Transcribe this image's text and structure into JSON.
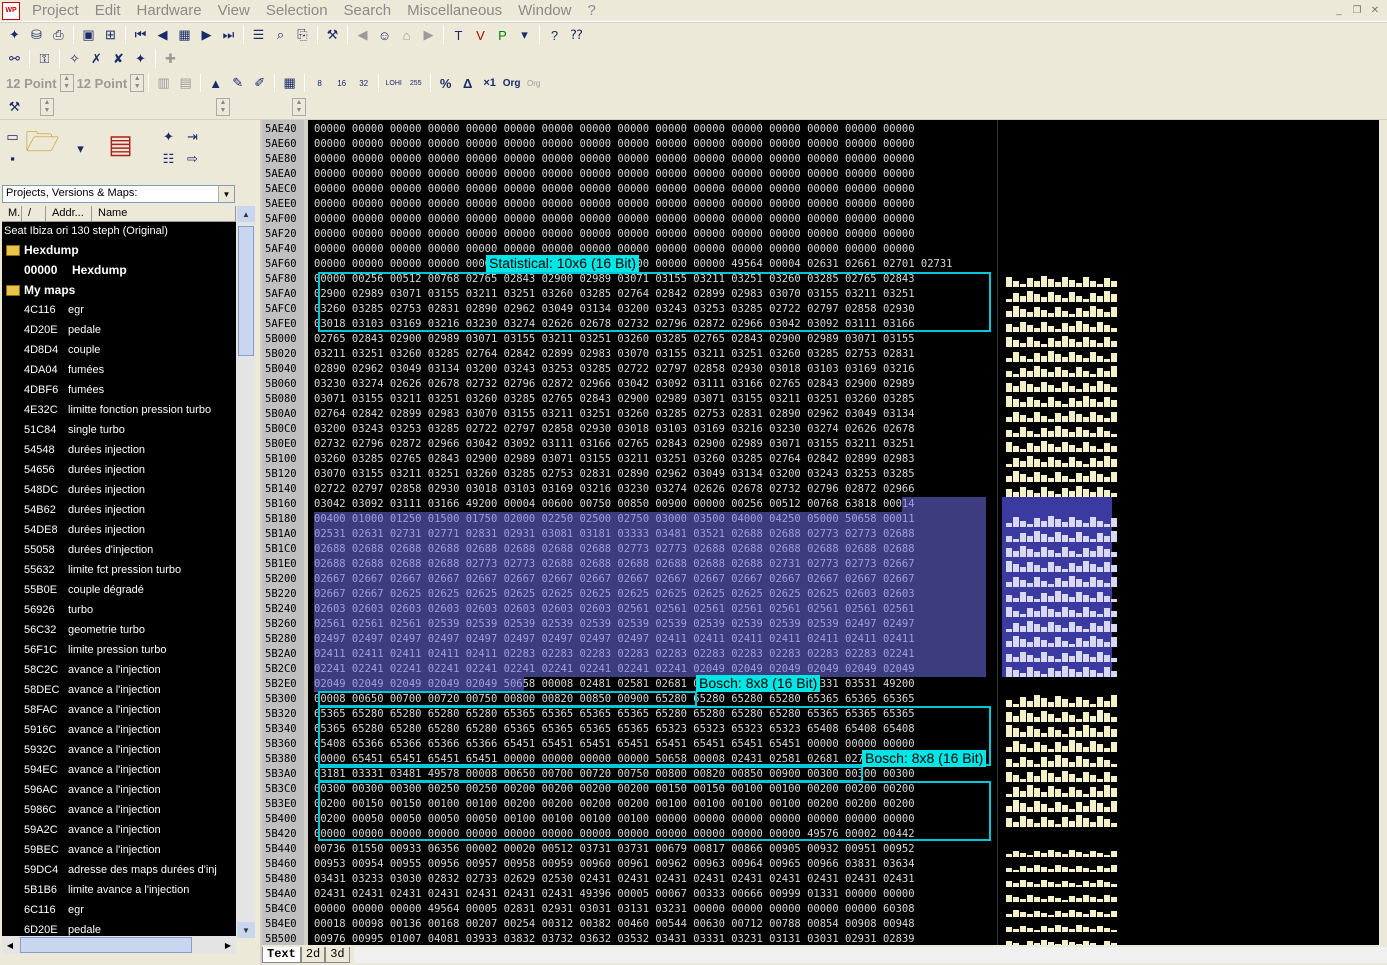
{
  "menu": [
    "Project",
    "Edit",
    "Hardware",
    "View",
    "Selection",
    "Search",
    "Miscellaneous",
    "Window",
    "?"
  ],
  "font_label_1": "12 Point",
  "font_label_2": "12 Point",
  "projects_combo": "Projects, Versions & Maps:",
  "list_headers": [
    "M.",
    "/",
    "Addr...",
    "Name"
  ],
  "project_root": "Seat Ibiza ori 130 steph (Original)",
  "group_hexdump": "Hexdump",
  "hexdump_row": {
    "addr": "00000",
    "name": "Hexdump"
  },
  "group_maps": "My maps",
  "maps": [
    [
      "4C116",
      "egr"
    ],
    [
      "4D20E",
      "pedale"
    ],
    [
      "4D8D4",
      "couple"
    ],
    [
      "4DA04",
      "fumées"
    ],
    [
      "4DBF6",
      "fumées"
    ],
    [
      "4E32C",
      "limitte fonction pression turbo"
    ],
    [
      "51C84",
      "single turbo"
    ],
    [
      "54548",
      "durées injection"
    ],
    [
      "54656",
      "durées injection"
    ],
    [
      "548DC",
      "durées injection"
    ],
    [
      "54B62",
      "durées injection"
    ],
    [
      "54DE8",
      "durées injection"
    ],
    [
      "55058",
      "durées d'injection"
    ],
    [
      "55632",
      "limite fct pression turbo"
    ],
    [
      "55B0E",
      "couple dégradé"
    ],
    [
      "56926",
      "turbo"
    ],
    [
      "56C32",
      "geometrie turbo"
    ],
    [
      "56F1C",
      "limite pression turbo"
    ],
    [
      "58C2C",
      "avance a l'injection"
    ],
    [
      "58DEC",
      "avance a l'injection"
    ],
    [
      "58FAC",
      "avance a l'injection"
    ],
    [
      "5916C",
      "avance a l'injection"
    ],
    [
      "5932C",
      "avance a l'injection"
    ],
    [
      "594EC",
      "avance a l'injection"
    ],
    [
      "596AC",
      "avance a l'injection"
    ],
    [
      "5986C",
      "avance a l'injection"
    ],
    [
      "59A2C",
      "avance a l'injection"
    ],
    [
      "59BEC",
      "avance a l'injection"
    ],
    [
      "59DC4",
      "adresse des maps durées d'inj"
    ],
    [
      "5B1B6",
      "limite avance a l'injection"
    ],
    [
      "6C116",
      "egr"
    ],
    [
      "6D20E",
      "pedale"
    ]
  ],
  "addresses": [
    "5AE40",
    "5AE60",
    "5AE80",
    "5AEA0",
    "5AEC0",
    "5AEE0",
    "5AF00",
    "5AF20",
    "5AF40",
    "5AF60",
    "5AF80",
    "5AFA0",
    "5AFC0",
    "5AFE0",
    "5B000",
    "5B020",
    "5B040",
    "5B060",
    "5B080",
    "5B0A0",
    "5B0C0",
    "5B0E0",
    "5B100",
    "5B120",
    "5B140",
    "5B160",
    "5B180",
    "5B1A0",
    "5B1C0",
    "5B1E0",
    "5B200",
    "5B220",
    "5B240",
    "5B260",
    "5B280",
    "5B2A0",
    "5B2C0",
    "5B2E0",
    "5B300",
    "5B320",
    "5B340",
    "5B360",
    "5B380",
    "5B3A0",
    "5B3C0",
    "5B3E0",
    "5B400",
    "5B420",
    "5B440",
    "5B460",
    "5B480",
    "5B4A0",
    "5B4C0",
    "5B4E0",
    "5B500"
  ],
  "rows": [
    "00000 00000 00000 00000 00000 00000 00000 00000 00000 00000 00000 00000 00000 00000 00000 00000",
    "00000 00000 00000 00000 00000 00000 00000 00000 00000 00000 00000 00000 00000 00000 00000 00000",
    "00000 00000 00000 00000 00000 00000 00000 00000 00000 00000 00000 00000 00000 00000 00000 00000",
    "00000 00000 00000 00000 00000 00000 00000 00000 00000 00000 00000 00000 00000 00000 00000 00000",
    "00000 00000 00000 00000 00000 00000 00000 00000 00000 00000 00000 00000 00000 00000 00000 00000",
    "00000 00000 00000 00000 00000 00000 00000 00000 00000 00000 00000 00000 00000 00000 00000 00000",
    "00000 00000 00000 00000 00000 00000 00000 00000 00000 00000 00000 00000 00000 00000 00000 00000",
    "00000 00000 00000 00000 00000 00000 00000 00000 00000 00000 00000 00000 00000 00000 00000 00000",
    "00000 00000 00000 00000 00000 00000 00000 00000 00000 00000 00000 00000 00000 00000 00000 00000",
    "00000 00000 00000 00000 00000 00000 00000 00000 00000 00000 00000 49564 00004 02631 02661 02701 02731",
    "00000 00256 00512 00768 02765 02843 02900 02989 03071 03155 03211 03251 03260 03285 02765 02843",
    "02900 02989 03071 03155 03211 03251 03260 03285 02764 02842 02899 02983 03070 03155 03211 03251",
    "03260 03285 02753 02831 02890 02962 03049 03134 03200 03243 03253 03285 02722 02797 02858 02930",
    "03018 03103 03169 03216 03230 03274 02626 02678 02732 02796 02872 02966 03042 03092 03111 03166",
    "02765 02843 02900 02989 03071 03155 03211 03251 03260 03285 02765 02843 02900 02989 03071 03155",
    "03211 03251 03260 03285 02764 02842 02899 02983 03070 03155 03211 03251 03260 03285 02753 02831",
    "02890 02962 03049 03134 03200 03243 03253 03285 02722 02797 02858 02930 03018 03103 03169 03216",
    "03230 03274 02626 02678 02732 02796 02872 02966 03042 03092 03111 03166 02765 02843 02900 02989",
    "03071 03155 03211 03251 03260 03285 02765 02843 02900 02989 03071 03155 03211 03251 03260 03285",
    "02764 02842 02899 02983 03070 03155 03211 03251 03260 03285 02753 02831 02890 02962 03049 03134",
    "03200 03243 03253 03285 02722 02797 02858 02930 03018 03103 03169 03216 03230 03274 02626 02678",
    "02732 02796 02872 02966 03042 03092 03111 03166 02765 02843 02900 02989 03071 03155 03211 03251",
    "03260 03285 02765 02843 02900 02989 03071 03155 03211 03251 03260 03285 02764 02842 02899 02983",
    "03070 03155 03211 03251 03260 03285 02753 02831 02890 02962 03049 03134 03200 03243 03253 03285",
    "02722 02797 02858 02930 03018 03103 03169 03216 03230 03274 02626 02678 02732 02796 02872 02966",
    "03042 03092 03111 03166 49200 00004 00600 00750 00850 00900 00000 00256 00512 00768 63818 00014",
    "00400 01000 01250 01500 01750 02000 02250 02500 02750 03000 03500 04000 04250 05000 50658 00011",
    "02531 02631 02731 02771 02831 02931 03081 03181 03333 03481 03521 02688 02688 02773 02773 02688",
    "02688 02688 02688 02688 02688 02688 02688 02688 02773 02773 02688 02688 02688 02688 02688 02688",
    "02688 02688 02688 02688 02773 02773 02688 02688 02688 02688 02688 02688 02731 02773 02773 02667",
    "02667 02667 02667 02667 02667 02667 02667 02667 02667 02667 02667 02667 02667 02667 02667 02667",
    "02667 02667 02625 02625 02625 02625 02625 02625 02625 02625 02625 02625 02625 02625 02603 02603",
    "02603 02603 02603 02603 02603 02603 02603 02603 02561 02561 02561 02561 02561 02561 02561 02561",
    "02561 02561 02561 02539 02539 02539 02539 02539 02539 02539 02539 02539 02539 02539 02497 02497",
    "02497 02497 02497 02497 02497 02497 02497 02497 02497 02411 02411 02411 02411 02411 02411 02411",
    "02411 02411 02411 02411 02411 02283 02283 02283 02283 02283 02283 02283 02283 02283 02283 02241",
    "02241 02241 02241 02241 02241 02241 02241 02241 02241 02241 02049 02049 02049 02049 02049 02049",
    "02049 02049 02049 02049 02049 50658 00008 02481 02581 02681 02781 02881 03131 03331 03531 49200",
    "00008 00650 00700 00720 00750 00800 00820 00850 00900 65280 65280 65280 65280 65365 65365 65365",
    "65365 65280 65280 65280 65280 65365 65365 65365 65365 65280 65280 65280 65280 65365 65365 65365",
    "65365 65280 65280 65280 65280 65365 65365 65365 65365 65323 65323 65323 65323 65408 65408 65408",
    "65408 65366 65366 65366 65366 65451 65451 65451 65451 65451 65451 65451 65451 00000 00000 00000",
    "00000 65451 65451 65451 65451 00000 00000 00000 00000 50658 00008 02431 02581 02681 02781 02881",
    "03181 03331 03481 49578 00008 00650 00700 00720 00750 00800 00820 00850 00900 00300 00300 00300",
    "00300 00300 00300 00250 00250 00200 00200 00200 00200 00150 00150 00100 00100 00200 00200 00200",
    "00200 00150 00150 00100 00100 00200 00200 00200 00200 00100 00100 00100 00100 00200 00200 00200",
    "00200 00050 00050 00050 00050 00100 00100 00100 00100 00000 00000 00000 00000 00000 00000 00000",
    "00000 00000 00000 00000 00000 00000 00000 00000 00000 00000 00000 00000 00000 49576 00002 00442",
    "00736 01550 00933 06356 00002 00020 00512 03731 03731 00679 00817 00866 00905 00932 00951 00952",
    "00953 00954 00955 00956 00957 00958 00959 00960 00961 00962 00963 00964 00965 00966 03831 03634",
    "03431 03233 03030 02832 02733 02629 02530 02431 02431 02431 02431 02431 02431 02431 02431 02431",
    "02431 02431 02431 02431 02431 02431 02431 49396 00005 00067 00333 00666 00999 01331 00000 00000",
    "00000 00000 00000 49564 00005 02831 02931 03031 03131 03231 00000 00000 00000 00000 00000 60308",
    "00018 00098 00136 00168 00207 00254 00312 00382 00460 00544 00630 00712 00788 00854 00908 00948",
    "00976 00995 01007 04081 03933 03832 03732 03632 03532 03431 03331 03231 03131 03031 02931 02839"
  ],
  "map_labels": [
    {
      "text": "Statistical: 10x6 (16 Bit)"
    },
    {
      "text": "Bosch: 8x8 (16 Bit)"
    },
    {
      "text": "Bosch: 8x8 (16 Bit)"
    }
  ],
  "view_tabs": [
    "Text",
    "2d",
    "3d"
  ]
}
